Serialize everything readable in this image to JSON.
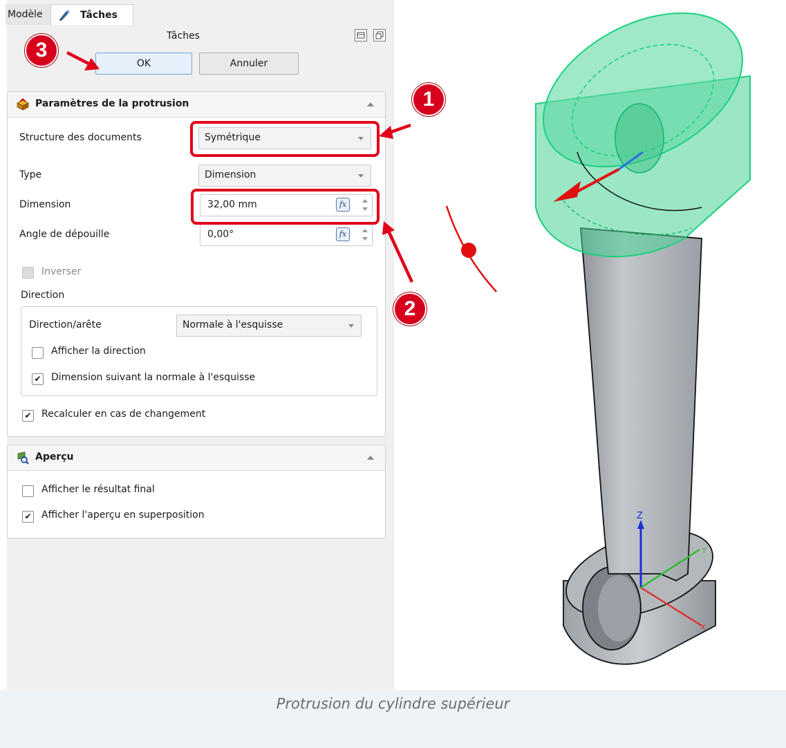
{
  "tabs": {
    "model": "Modèle",
    "tasks": "Tâches"
  },
  "task_panel": {
    "title": "Tâches",
    "ok_label": "OK",
    "cancel_label": "Annuler"
  },
  "protrusion_params": {
    "title": "Paramètres de la protrusion",
    "mode_label": "Structure des documents",
    "mode_value": "Symétrique",
    "type_label": "Type",
    "type_value": "Dimension",
    "dimension_label": "Dimension",
    "dimension_value": "32,00 mm",
    "taper_label": "Angle de dépouille",
    "taper_value": "0,00°",
    "reverse_label": "Inverser",
    "direction_group_label": "Direction",
    "direction_edge_label": "Direction/arête",
    "direction_edge_value": "Normale à l'esquisse",
    "show_direction_label": "Afficher la direction",
    "length_along_normal_label": "Dimension suivant la normale à l'esquisse",
    "recompute_label": "Recalculer en cas de changement",
    "fx_label": "fx"
  },
  "checkboxes": {
    "reverse": false,
    "show_direction": false,
    "length_along_normal": true,
    "recompute": true,
    "show_final": false,
    "show_overlay": true
  },
  "preview": {
    "title": "Aperçu",
    "show_final_label": "Afficher le résultat final",
    "show_overlay_label": "Afficher l'aperçu en superposition"
  },
  "callouts": {
    "one": "1",
    "two": "2",
    "three": "3"
  },
  "axes": {
    "z": "Z",
    "y": "Y",
    "x": "X"
  },
  "caption": "Protrusion du cylindre supérieur",
  "colors": {
    "callout_red": "#e0001a",
    "preview_green": "#47d296",
    "part_grey": "#a9aeb3"
  }
}
